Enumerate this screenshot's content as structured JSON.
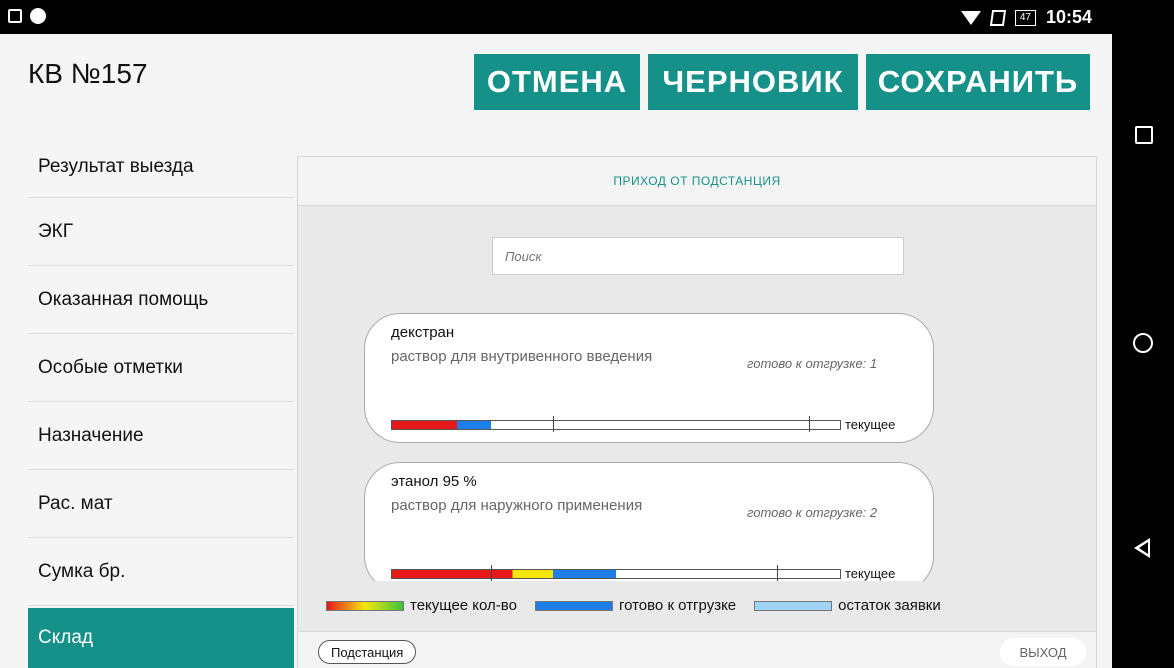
{
  "status_bar": {
    "battery": "47",
    "time": "10:54"
  },
  "header": {
    "title": "КВ №157",
    "buttons": {
      "cancel": "ОТМЕНА",
      "draft": "ЧЕРНОВИК",
      "save": "СОХРАНИТЬ"
    }
  },
  "sidebar": {
    "items": [
      {
        "label": "Результат выезда"
      },
      {
        "label": "ЭКГ"
      },
      {
        "label": "Оказанная помощь"
      },
      {
        "label": "Особые отметки"
      },
      {
        "label": "Назначение"
      },
      {
        "label": "Рас. мат"
      },
      {
        "label": "Сумка бр."
      },
      {
        "label": "Склад",
        "active": true
      }
    ]
  },
  "panel": {
    "title": "ПРИХОД ОТ ПОДСТАНЦИЯ",
    "search_placeholder": "Поиск",
    "items": [
      {
        "name": "декстран",
        "description": "раствор для внутривенного введения",
        "ready": "готово к отгрузке: 1",
        "bar_label": "текущее",
        "current_fraction": 0.145,
        "ready_fraction": 0.075,
        "markers": [
          0.36,
          0.93
        ]
      },
      {
        "name": "этанол 95 %",
        "description": "раствор для наружного применения",
        "ready": "готово к отгрузке: 2",
        "bar_label": "текущее",
        "current_fraction": 0.36,
        "ready_fraction": 0.14,
        "markers": [
          0.22,
          0.86
        ]
      }
    ],
    "legend": {
      "current": "текущее кол-во",
      "ready": "готово к отгрузке",
      "remaining": "остаток заявки"
    },
    "footer": {
      "substation": "Подстанция",
      "exit": "ВЫХОД"
    }
  },
  "colors": {
    "accent": "#15918a",
    "ready": "#1e7ee8",
    "remaining": "#9fd4f5",
    "red": "#e8191a",
    "yellow": "#f5e60e",
    "green": "#3cc43c"
  }
}
